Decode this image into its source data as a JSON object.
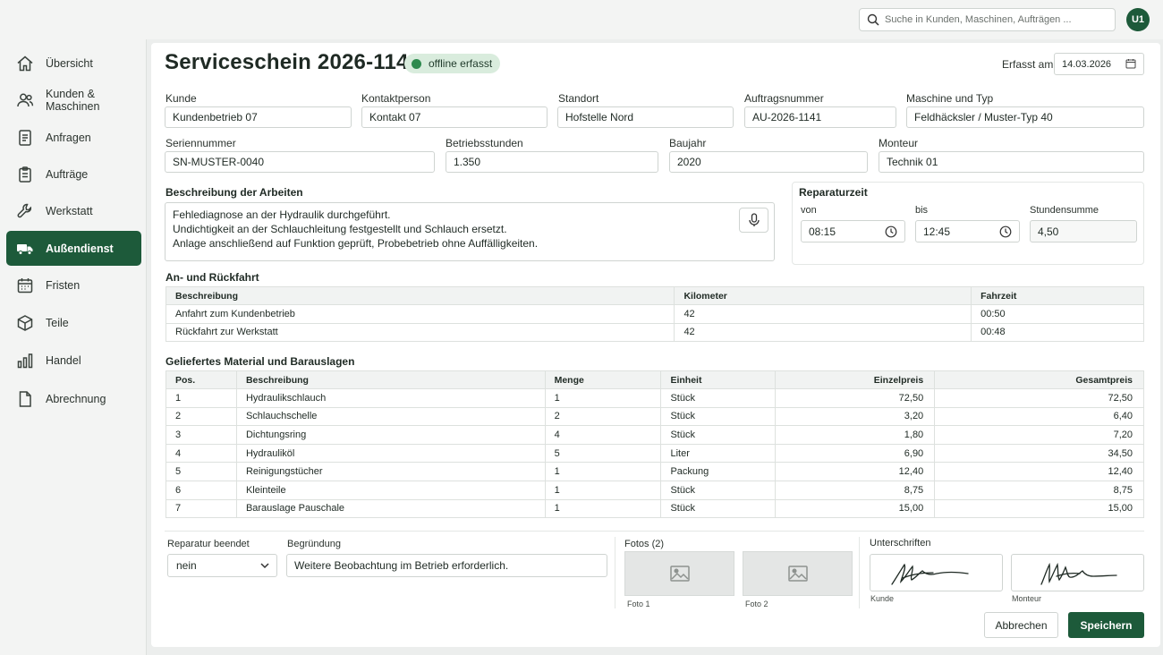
{
  "search": {
    "placeholder": "Suche in Kunden, Maschinen, Aufträgen ..."
  },
  "user": {
    "initials": "U1"
  },
  "sidebar": {
    "items": [
      {
        "label": "Übersicht",
        "icon": "home-icon"
      },
      {
        "label": "Kunden & Maschinen",
        "icon": "users-icon"
      },
      {
        "label": "Anfragen",
        "icon": "document-icon"
      },
      {
        "label": "Aufträge",
        "icon": "clipboard-icon"
      },
      {
        "label": "Werkstatt",
        "icon": "wrench-icon"
      },
      {
        "label": "Außendienst",
        "icon": "truck-icon",
        "active": true
      },
      {
        "label": "Fristen",
        "icon": "calendar-icon"
      },
      {
        "label": "Teile",
        "icon": "box-icon"
      },
      {
        "label": "Handel",
        "icon": "bar-chart-icon"
      },
      {
        "label": "Abrechnung",
        "icon": "file-icon"
      }
    ]
  },
  "header": {
    "title": "Serviceschein 2026-1141",
    "status": "offline erfasst",
    "date_label": "Erfasst am",
    "date_value": "14.03.2026"
  },
  "fields": {
    "kunde": {
      "label": "Kunde",
      "value": "Kundenbetrieb 07"
    },
    "kontakt": {
      "label": "Kontaktperson",
      "value": "Kontakt 07"
    },
    "standort": {
      "label": "Standort",
      "value": "Hofstelle Nord"
    },
    "auftrag": {
      "label": "Auftragsnummer",
      "value": "AU-2026-1141"
    },
    "maschine": {
      "label": "Maschine und Typ",
      "value": "Feldhäcksler / Muster-Typ 40"
    },
    "serien": {
      "label": "Seriennummer",
      "value": "SN-MUSTER-0040"
    },
    "betrieb": {
      "label": "Betriebsstunden",
      "value": "1.350"
    },
    "baujahr": {
      "label": "Baujahr",
      "value": "2020"
    },
    "monteur": {
      "label": "Monteur",
      "value": "Technik 01"
    }
  },
  "description": {
    "label": "Beschreibung der Arbeiten",
    "lines": [
      "Fehlediagnose an der Hydraulik durchgeführt.",
      "Undichtigkeit an der Schlauchleitung festgestellt und Schlauch ersetzt.",
      "Anlage anschließend auf Funktion geprüft, Probebetrieb ohne Auffälligkeiten."
    ]
  },
  "repair_time": {
    "label": "Reparaturzeit",
    "from_label": "von",
    "from_value": "08:15",
    "to_label": "bis",
    "to_value": "12:45",
    "sum_label": "Stundensumme",
    "sum_value": "4,50"
  },
  "travel": {
    "label": "An- und Rückfahrt",
    "headers": [
      "Beschreibung",
      "Kilometer",
      "Fahrzeit"
    ],
    "rows": [
      [
        "Anfahrt zum Kundenbetrieb",
        "42",
        "00:50"
      ],
      [
        "Rückfahrt zur Werkstatt",
        "42",
        "00:48"
      ]
    ]
  },
  "material": {
    "label": "Geliefertes Material und Barauslagen",
    "headers": [
      "Pos.",
      "Beschreibung",
      "Menge",
      "Einheit",
      "Einzelpreis",
      "Gesamtpreis"
    ],
    "rows": [
      [
        "1",
        "Hydraulikschlauch",
        "1",
        "Stück",
        "72,50",
        "72,50"
      ],
      [
        "2",
        "Schlauchschelle",
        "2",
        "Stück",
        "3,20",
        "6,40"
      ],
      [
        "3",
        "Dichtungsring",
        "4",
        "Stück",
        "1,80",
        "7,20"
      ],
      [
        "4",
        "Hydrauliköl",
        "5",
        "Liter",
        "6,90",
        "34,50"
      ],
      [
        "5",
        "Reinigungstücher",
        "1",
        "Packung",
        "12,40",
        "12,40"
      ],
      [
        "6",
        "Kleinteile",
        "1",
        "Stück",
        "8,75",
        "8,75"
      ],
      [
        "7",
        "Barauslage Pauschale",
        "1",
        "Stück",
        "15,00",
        "15,00"
      ]
    ]
  },
  "footer": {
    "repair_done_label": "Reparatur beendet",
    "repair_done_value": "nein",
    "reason_label": "Begründung",
    "reason_value": "Weitere Beobachtung im Betrieb erforderlich.",
    "photos_label": "Fotos (2)",
    "photo1": "Foto 1",
    "photo2": "Foto 2",
    "signatures_label": "Unterschriften",
    "sig_customer": "Kunde",
    "sig_fitter": "Monteur",
    "cancel": "Abbrechen",
    "save": "Speichern"
  }
}
